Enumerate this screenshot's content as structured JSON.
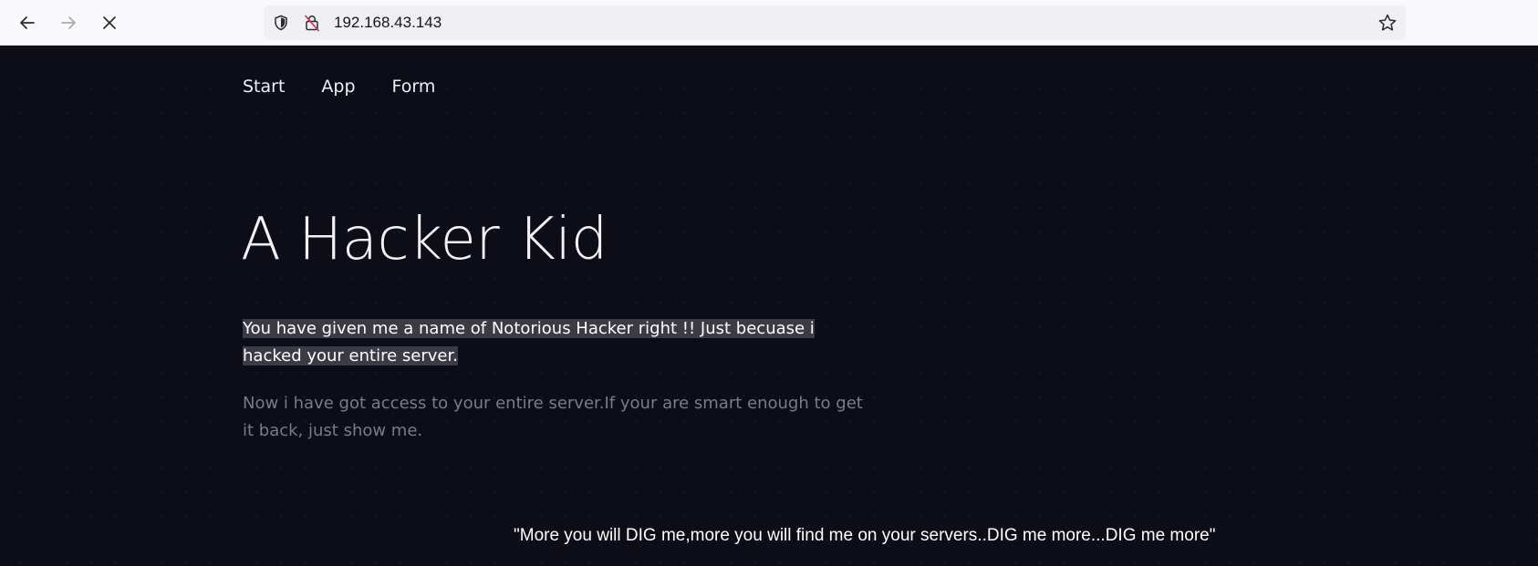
{
  "browser": {
    "url": "192.168.43.143"
  },
  "nav": {
    "items": [
      {
        "label": "Start"
      },
      {
        "label": "App"
      },
      {
        "label": "Form"
      }
    ]
  },
  "hero": {
    "title": "A Hacker Kid",
    "lead": "You have given me a name of Notorious Hacker right !! Just becuase i hacked your entire server.",
    "sub": "Now i have got access to your entire server.If your are smart enough to get it back, just show me."
  },
  "footer": {
    "quote": "\"More you will DIG me,more you will find me on your servers..DIG me more...DIG me more\""
  },
  "icons": {
    "back": "arrow-left-icon",
    "forward": "arrow-right-icon",
    "stop": "close-icon",
    "shield": "shield-icon",
    "lock": "insecure-lock-icon",
    "bookmark": "star-icon"
  },
  "colors": {
    "page_background": "#0d0d17",
    "lead_highlight": "#3b3b46",
    "muted_text": "#7a7b88",
    "browser_chrome": "#f9f9fb"
  }
}
